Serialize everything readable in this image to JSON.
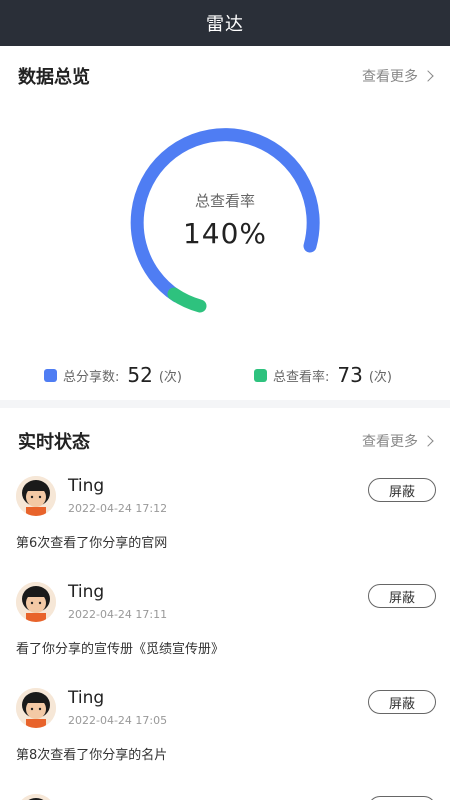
{
  "header": {
    "title": "雷达"
  },
  "overview": {
    "title": "数据总览",
    "more_label": "查看更多",
    "gauge": {
      "label": "总查看率",
      "value_text": "140%",
      "colors": {
        "track": "#4f7df3",
        "highlight": "#2ec27e"
      }
    },
    "stats": [
      {
        "label": "总分享数:",
        "value": "52",
        "unit": "(次)",
        "color": "#4f7df3"
      },
      {
        "label": "总查看率:",
        "value": "73",
        "unit": "(次)",
        "color": "#2ec27e"
      }
    ]
  },
  "realtime": {
    "title": "实时状态",
    "more_label": "查看更多",
    "items": [
      {
        "name": "Ting",
        "time": "2022-04-24 17:12",
        "button": "屏蔽",
        "text": "第6次查看了你分享的官网"
      },
      {
        "name": "Ting",
        "time": "2022-04-24 17:11",
        "button": "屏蔽",
        "text": "看了你分享的宣传册《觅绩宣传册》"
      },
      {
        "name": "Ting",
        "time": "2022-04-24 17:05",
        "button": "屏蔽",
        "text": "第8次查看了你分享的名片"
      }
    ]
  }
}
